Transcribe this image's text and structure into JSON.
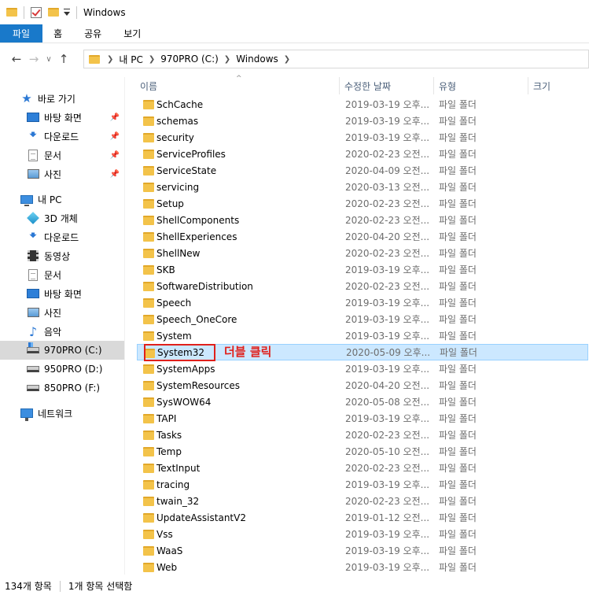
{
  "window": {
    "title": "Windows"
  },
  "ribbon": {
    "tabs": [
      "파일",
      "홈",
      "공유",
      "보기"
    ]
  },
  "address": {
    "crumbs": [
      "내 PC",
      "970PRO (C:)",
      "Windows"
    ]
  },
  "sidebar": {
    "quick_access": {
      "label": "바로 가기",
      "icon": "star-icon"
    },
    "quick_items": [
      {
        "label": "바탕 화면",
        "icon": "desktop-icon",
        "pinned": true
      },
      {
        "label": "다운로드",
        "icon": "download-icon",
        "pinned": true
      },
      {
        "label": "문서",
        "icon": "document-icon",
        "pinned": true
      },
      {
        "label": "사진",
        "icon": "pictures-icon",
        "pinned": true
      }
    ],
    "this_pc": {
      "label": "내 PC",
      "icon": "computer-icon"
    },
    "pc_items": [
      {
        "label": "3D 개체",
        "icon": "3d-objects-icon"
      },
      {
        "label": "다운로드",
        "icon": "download-icon"
      },
      {
        "label": "동영상",
        "icon": "video-icon"
      },
      {
        "label": "문서",
        "icon": "document-icon"
      },
      {
        "label": "바탕 화면",
        "icon": "desktop-icon"
      },
      {
        "label": "사진",
        "icon": "pictures-icon"
      },
      {
        "label": "음악",
        "icon": "music-icon"
      },
      {
        "label": "970PRO (C:)",
        "icon": "system-drive-icon",
        "selected": true
      },
      {
        "label": "950PRO (D:)",
        "icon": "drive-icon"
      },
      {
        "label": "850PRO (F:)",
        "icon": "drive-icon"
      }
    ],
    "network": {
      "label": "네트워크",
      "icon": "network-icon"
    }
  },
  "columns": {
    "name": "이름",
    "date": "수정한 날짜",
    "type": "유형",
    "size": "크기"
  },
  "files": [
    {
      "name": "SchCache",
      "date": "2019-03-19 오후...",
      "type": "파일 폴더"
    },
    {
      "name": "schemas",
      "date": "2019-03-19 오후...",
      "type": "파일 폴더"
    },
    {
      "name": "security",
      "date": "2019-03-19 오후...",
      "type": "파일 폴더"
    },
    {
      "name": "ServiceProfiles",
      "date": "2020-02-23 오전...",
      "type": "파일 폴더"
    },
    {
      "name": "ServiceState",
      "date": "2020-04-09 오전...",
      "type": "파일 폴더"
    },
    {
      "name": "servicing",
      "date": "2020-03-13 오전...",
      "type": "파일 폴더"
    },
    {
      "name": "Setup",
      "date": "2020-02-23 오전...",
      "type": "파일 폴더"
    },
    {
      "name": "ShellComponents",
      "date": "2020-02-23 오전...",
      "type": "파일 폴더"
    },
    {
      "name": "ShellExperiences",
      "date": "2020-04-20 오전...",
      "type": "파일 폴더"
    },
    {
      "name": "ShellNew",
      "date": "2020-02-23 오전...",
      "type": "파일 폴더"
    },
    {
      "name": "SKB",
      "date": "2019-03-19 오후...",
      "type": "파일 폴더"
    },
    {
      "name": "SoftwareDistribution",
      "date": "2020-02-23 오전...",
      "type": "파일 폴더"
    },
    {
      "name": "Speech",
      "date": "2019-03-19 오후...",
      "type": "파일 폴더"
    },
    {
      "name": "Speech_OneCore",
      "date": "2019-03-19 오후...",
      "type": "파일 폴더"
    },
    {
      "name": "System",
      "date": "2019-03-19 오후...",
      "type": "파일 폴더"
    },
    {
      "name": "System32",
      "date": "2020-05-09 오후...",
      "type": "파일 폴더",
      "selected": true,
      "annotation": "더블 클릭"
    },
    {
      "name": "SystemApps",
      "date": "2019-03-19 오후...",
      "type": "파일 폴더"
    },
    {
      "name": "SystemResources",
      "date": "2020-04-20 오전...",
      "type": "파일 폴더"
    },
    {
      "name": "SysWOW64",
      "date": "2020-05-08 오전...",
      "type": "파일 폴더"
    },
    {
      "name": "TAPI",
      "date": "2019-03-19 오후...",
      "type": "파일 폴더"
    },
    {
      "name": "Tasks",
      "date": "2020-02-23 오전...",
      "type": "파일 폴더"
    },
    {
      "name": "Temp",
      "date": "2020-05-10 오전...",
      "type": "파일 폴더"
    },
    {
      "name": "TextInput",
      "date": "2020-02-23 오전...",
      "type": "파일 폴더"
    },
    {
      "name": "tracing",
      "date": "2019-03-19 오후...",
      "type": "파일 폴더"
    },
    {
      "name": "twain_32",
      "date": "2020-02-23 오전...",
      "type": "파일 폴더"
    },
    {
      "name": "UpdateAssistantV2",
      "date": "2019-01-12 오전...",
      "type": "파일 폴더"
    },
    {
      "name": "Vss",
      "date": "2019-03-19 오후...",
      "type": "파일 폴더"
    },
    {
      "name": "WaaS",
      "date": "2019-03-19 오후...",
      "type": "파일 폴더"
    },
    {
      "name": "Web",
      "date": "2019-03-19 오후...",
      "type": "파일 폴더"
    }
  ],
  "status": {
    "item_count": "134개 항목",
    "selected": "1개 항목 선택함"
  },
  "colors": {
    "accent": "#1979ca",
    "selection": "#cce8ff",
    "annotation": "#e0201b",
    "folder": "#f3c34a"
  }
}
